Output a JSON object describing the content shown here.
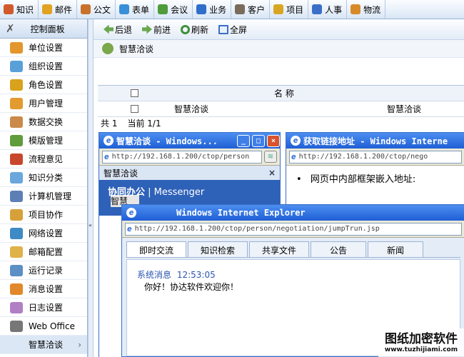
{
  "topmenu": [
    {
      "label": "知识",
      "icon": "knowledge-icon",
      "color": "#d2592b"
    },
    {
      "label": "邮件",
      "icon": "mail-icon",
      "color": "#e0a322"
    },
    {
      "label": "公文",
      "icon": "document-icon",
      "color": "#c9722c"
    },
    {
      "label": "表单",
      "icon": "form-icon",
      "color": "#3a8fd9"
    },
    {
      "label": "会议",
      "icon": "meeting-icon",
      "color": "#4f9c3a"
    },
    {
      "label": "业务",
      "icon": "business-icon",
      "color": "#2f6fc9"
    },
    {
      "label": "客户",
      "icon": "customer-icon",
      "color": "#7a6b5b"
    },
    {
      "label": "项目",
      "icon": "project-icon",
      "color": "#d9a624"
    },
    {
      "label": "人事",
      "icon": "hr-icon",
      "color": "#3a6fc9"
    },
    {
      "label": "物流",
      "icon": "logistics-icon",
      "color": "#d88a2a"
    }
  ],
  "sidebar": {
    "title": "控制面板",
    "items": [
      {
        "label": "单位设置",
        "icon": "unit-settings-icon",
        "color": "#e2962c"
      },
      {
        "label": "组织设置",
        "icon": "org-settings-icon",
        "color": "#5aa0d8"
      },
      {
        "label": "角色设置",
        "icon": "role-settings-icon",
        "color": "#d9a21c"
      },
      {
        "label": "用户管理",
        "icon": "user-management-icon",
        "color": "#e39a2e"
      },
      {
        "label": "数据交换",
        "icon": "data-exchange-icon",
        "color": "#c98a4a"
      },
      {
        "label": "模版管理",
        "icon": "template-icon",
        "color": "#5f9c3c"
      },
      {
        "label": "流程意见",
        "icon": "workflow-icon",
        "color": "#c8472c"
      },
      {
        "label": "知识分类",
        "icon": "knowledge-category-icon",
        "color": "#6aa7dc"
      },
      {
        "label": "计算机管理",
        "icon": "computer-icon",
        "color": "#5d7fb6"
      },
      {
        "label": "项目协作",
        "icon": "collaboration-icon",
        "color": "#d7a13a"
      },
      {
        "label": "网络设置",
        "icon": "network-icon",
        "color": "#3d8ac4"
      },
      {
        "label": "邮箱配置",
        "icon": "mailbox-icon",
        "color": "#e0b24a"
      },
      {
        "label": "运行记录",
        "icon": "log-run-icon",
        "color": "#5b8fc5"
      },
      {
        "label": "消息设置",
        "icon": "message-icon",
        "color": "#e2882a"
      },
      {
        "label": "日志设置",
        "icon": "diary-icon",
        "color": "#b07fc4"
      },
      {
        "label": "Web Office",
        "icon": "web-office-icon",
        "color": "#777777"
      }
    ],
    "active_item": {
      "label": "智慧洽谈",
      "arrow": "›"
    }
  },
  "splitter_arrow": "«",
  "toolbar": {
    "back": "后退",
    "forward": "前进",
    "refresh": "刷新",
    "fullscreen": "全屏"
  },
  "breadcrumb": "智慧洽谈",
  "grid": {
    "header": "名 称",
    "row_cells": [
      "智慧洽谈",
      "智慧洽谈"
    ]
  },
  "pager": {
    "total": "共 1",
    "current": "当前 1/1"
  },
  "win1": {
    "title": "智慧洽谈 - Windows...",
    "url": "http://192.168.1.200/ctop/person",
    "panel_title": "智慧洽谈",
    "panel_close": "×",
    "messenger_a": "协同办公",
    "messenger_sep": " | ",
    "messenger_b": "Messenger",
    "overlap_text": "智慧"
  },
  "win2": {
    "title": "获取链接地址 - Windows Interne",
    "url": "http://192.168.1.200/ctop/nego",
    "bullet": "网页中内部框架嵌入地址:"
  },
  "win3": {
    "title": "Windows Internet Explorer",
    "url": "http://192.168.1.200/ctop/person/negotiation/jumpTrun.jsp",
    "tabs": [
      "即时交流",
      "知识检索",
      "共享文件",
      "公告",
      "新闻"
    ],
    "msg_sender": "系统消息",
    "msg_time": "12:53:05",
    "msg_text": "你好！协达软件欢迎你！"
  },
  "watermark": {
    "line1": "图纸加密软件",
    "line2": "www.tuzhijiami.com"
  }
}
